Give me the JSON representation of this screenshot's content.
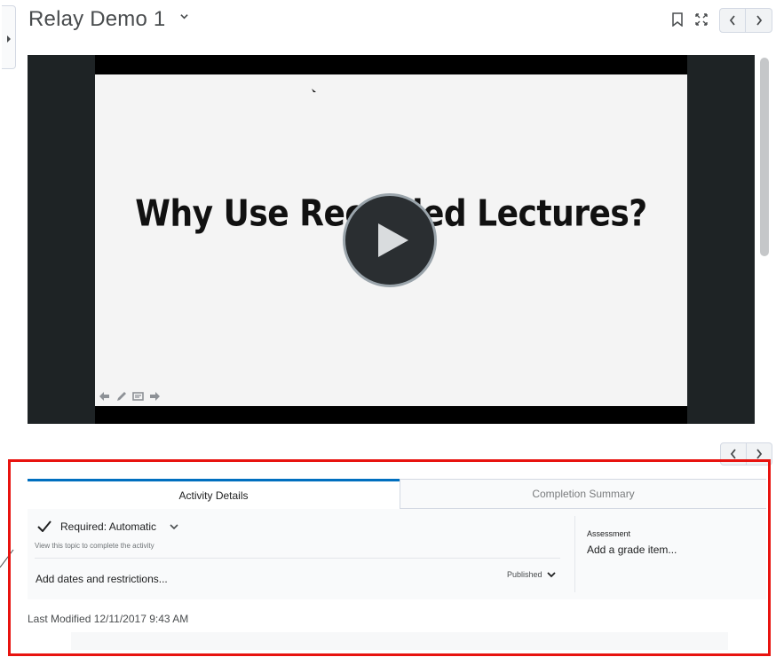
{
  "header": {
    "title": "Relay Demo 1",
    "icons": [
      "chevron-down-icon",
      "bookmark-icon",
      "fullscreen-icon",
      "chevron-left-icon",
      "chevron-right-icon"
    ]
  },
  "video": {
    "slide_title": "Why Use Recorded Lectures?",
    "play_icon": "play-icon",
    "controls": [
      "arrow-left-icon",
      "pen-icon",
      "slide-icon",
      "arrow-right-icon"
    ]
  },
  "tabs": {
    "activity_details": "Activity Details",
    "completion_summary": "Completion Summary"
  },
  "details": {
    "required_label": "Required: Automatic",
    "required_hint": "View this topic to complete the activity",
    "dates_link": "Add dates and restrictions...",
    "published_label": "Published",
    "assessment_label": "Assessment",
    "assessment_link": "Add a grade item..."
  },
  "footer": {
    "last_modified": "Last Modified 12/11/2017 9:43 AM"
  },
  "colors": {
    "accent": "#006fbf",
    "highlight": "#e8130f",
    "video_background": "#1e2325"
  }
}
